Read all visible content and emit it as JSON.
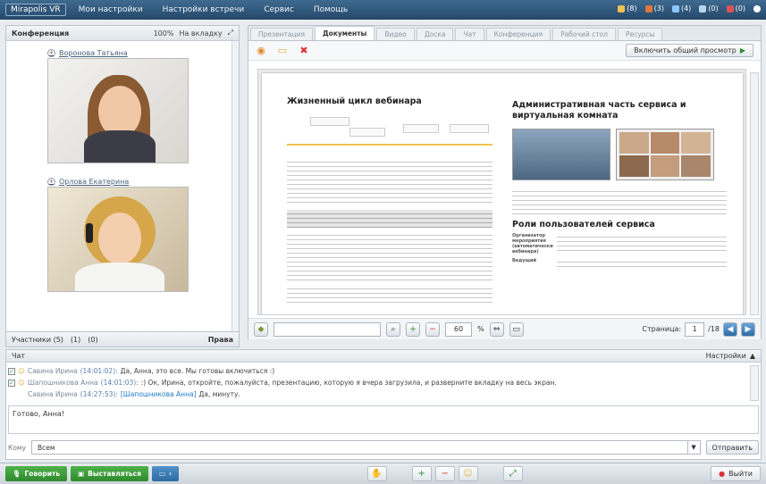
{
  "topbar": {
    "logo": "Mirapolis VR",
    "menu": [
      "Мои настройки",
      "Настройки встречи",
      "Сервис",
      "Помощь"
    ],
    "stats": [
      "(8)",
      "(3)",
      "(4)",
      "(0)",
      "(0)"
    ]
  },
  "left_panel": {
    "title": "Конференция",
    "zoom": "100%",
    "tab_mode": "На вкладку",
    "participants": [
      {
        "name": "Воронова Татьяна"
      },
      {
        "name": "Орлова Екатерина"
      }
    ],
    "footer": {
      "participants": "Участники (5)",
      "count1": "(1)",
      "count2": "(0)",
      "rights": "Права"
    }
  },
  "right_panel": {
    "tabs": [
      "Презентация",
      "Документы",
      "Видео",
      "Доска",
      "Чат",
      "Конференция",
      "Рабочий стол",
      "Ресурсы"
    ],
    "active_tab": "Документы",
    "share_button": "Включить общий просмотр",
    "document": {
      "left_title": "Жизненный цикл вебинара",
      "right_title": "Административная часть сервиса и виртуальная комната",
      "roles_title": "Роли пользователей сервиса",
      "roles": [
        "Организатор мероприятия (автоматически вебинара)",
        "Ведущий"
      ]
    },
    "nav": {
      "zoom": "60",
      "zoom_unit": "%",
      "page_label": "Страница:",
      "page": "1",
      "total": "/18"
    }
  },
  "chat": {
    "title": "Чат",
    "settings": "Настройки",
    "messages": [
      {
        "name": "Савина Ирина",
        "time": "(14:01:02):",
        "text": "Да, Анна, это все. Мы готовы включиться :)"
      },
      {
        "name": "Шапошникова Анна",
        "time": "(14:01:03):",
        "text": ":) Ок, Ирина, откройте, пожалуйста, презентацию, которую я вчера загрузила, и разверните вкладку на весь экран."
      },
      {
        "name": "Савина Ирина",
        "time": "(14:27:53):",
        "mention": "[Шапошникова Анна]",
        "text": "Да, минуту."
      }
    ],
    "input_text": "Готово, Анна!",
    "to_label": "Кому",
    "to_value": "Всем",
    "send_button": "Отправить"
  },
  "bottombar": {
    "speak": "Говорить",
    "highlight": "Выставляться",
    "exit": "Выйти"
  },
  "colors": {
    "topbar": "#2f5478",
    "green": "#2d8a2c",
    "blue": "#2e6ba3",
    "link": "#1f78c8"
  }
}
